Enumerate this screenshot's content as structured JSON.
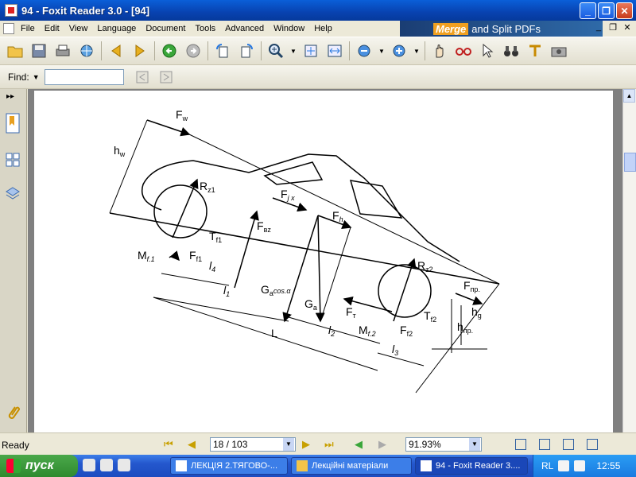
{
  "window": {
    "title": "94 - Foxit Reader 3.0 - [94]"
  },
  "menu": [
    "File",
    "Edit",
    "View",
    "Language",
    "Document",
    "Tools",
    "Advanced",
    "Window",
    "Help"
  ],
  "ad": {
    "highlight": "Merge",
    "text": "and Split PDFs"
  },
  "find": {
    "label": "Find:",
    "value": ""
  },
  "status": {
    "ready": "Ready",
    "page": "18 / 103",
    "zoom": "91.93%"
  },
  "diagram": {
    "fw": "F",
    "fw_sub": "w",
    "hw": "h",
    "hw_sub": "w",
    "rz1": "R",
    "rz1_sub": "z1",
    "rz2": "R",
    "rz2_sub": "z2",
    "fj": "F",
    "fj_sub": "j x",
    "fh": "F",
    "fh_sub": "h",
    "fbz": "F",
    "fbz_sub": "вz",
    "tf1": "T",
    "tf1_sub": "f1",
    "tf2": "T",
    "tf2_sub": "f2",
    "mf1": "M",
    "mf1_sub": "f.1",
    "mf2": "M",
    "mf2_sub": "f.2",
    "ff1": "F",
    "ff1_sub": "f1",
    "ff2": "F",
    "ff2_sub": "f2",
    "l4": "l",
    "l4_sub": "4",
    "l1": "l",
    "l1_sub": "1",
    "l2": "l",
    "l2_sub": "2",
    "l3": "l",
    "l3_sub": "3",
    "L": "L",
    "gcos": "G",
    "gcos_sub": "a",
    "gcos_tail": "cos.α",
    "ga": "G",
    "ga_sub": "a",
    "ft": "F",
    "ft_sub": "т",
    "fpr": "F",
    "fpr_sub": "пр.",
    "hg": "h",
    "hg_sub": "g",
    "hpr": "h",
    "hpr_sub": "пр."
  },
  "taskbar": {
    "start": "пуск",
    "tasks": [
      "ЛЕКЦІЯ 2.ТЯГОВО-...",
      "Лекційні матеріали",
      "94 - Foxit Reader 3...."
    ],
    "lang": "RL",
    "clock": "12:55"
  }
}
